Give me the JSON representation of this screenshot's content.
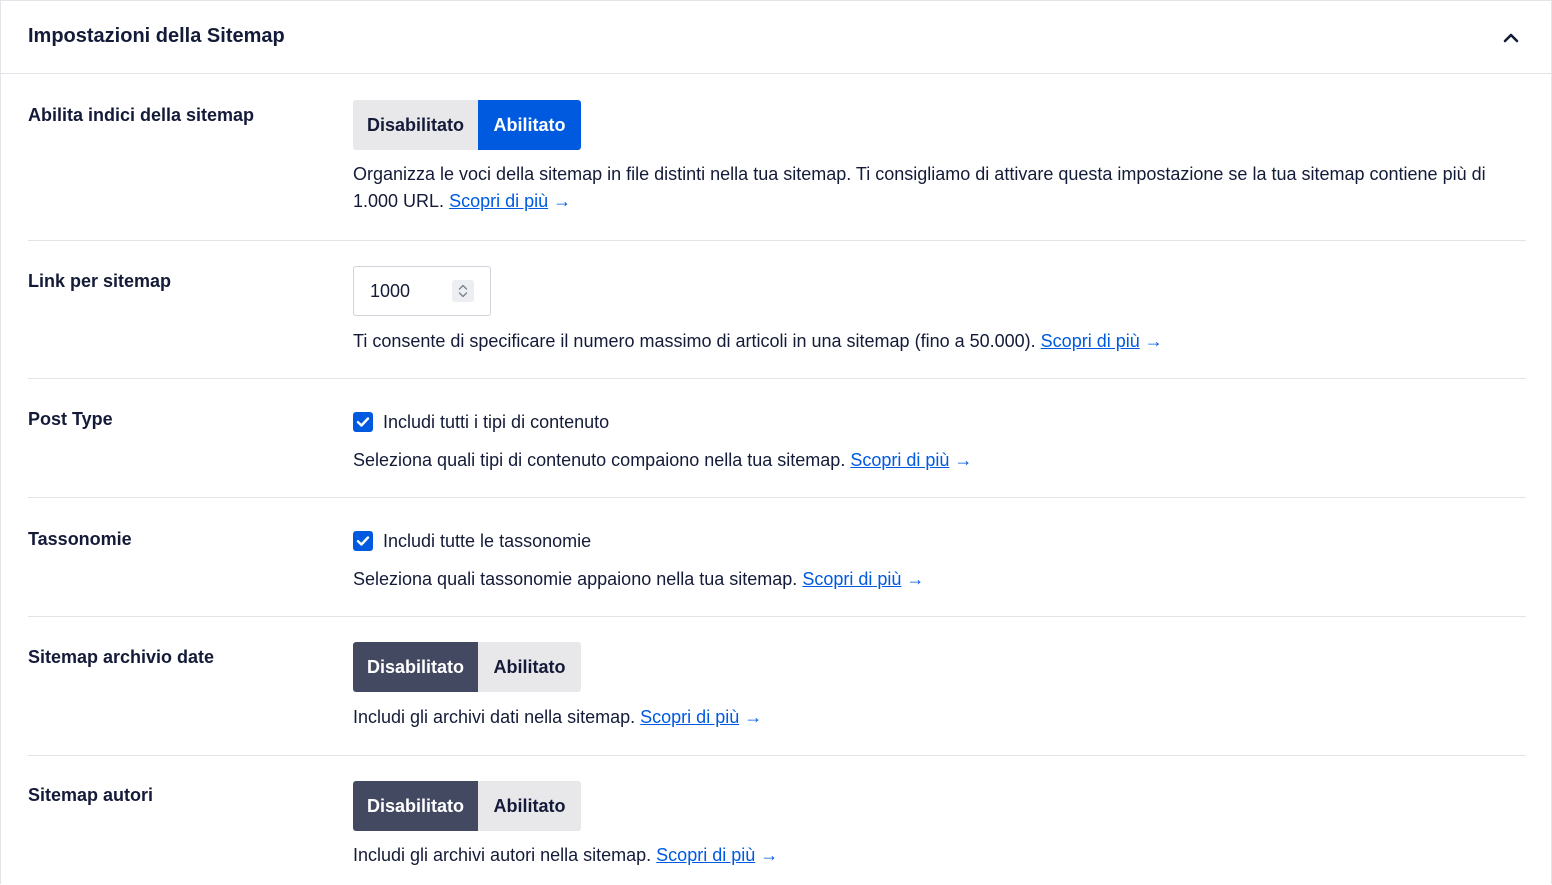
{
  "header": {
    "title": "Impostazioni della Sitemap",
    "collapse_icon": "chevron-up-icon"
  },
  "rows": [
    {
      "label": "Abilita indici della sitemap",
      "control": "toggle",
      "options": [
        "Disabilitato",
        "Abilitato"
      ],
      "selected": "Abilitato",
      "description": "Organizza le voci della sitemap in file distinti nella tua sitemap. Ti consigliamo di attivare questa impostazione se la tua sitemap contiene più di 1.000 URL.",
      "link": "Scopri di più",
      "arrow": "→"
    },
    {
      "label": "Link per sitemap",
      "control": "number",
      "value": "1000",
      "description": "Ti consente di specificare il numero massimo di articoli in una sitemap (fino a 50.000).",
      "link": "Scopri di più",
      "arrow": "→"
    },
    {
      "label": "Post Type",
      "control": "checkbox",
      "checkbox_label": "Includi tutti i tipi di contenuto",
      "checked": true,
      "description": "Seleziona quali tipi di contenuto compaiono nella tua sitemap.",
      "link": "Scopri di più",
      "arrow": "→"
    },
    {
      "label": "Tassonomie",
      "control": "checkbox",
      "checkbox_label": "Includi tutte le tassonomie",
      "checked": true,
      "description": "Seleziona quali tassonomie appaiono nella tua sitemap.",
      "link": "Scopri di più",
      "arrow": "→"
    },
    {
      "label": "Sitemap archivio date",
      "control": "toggle",
      "options": [
        "Disabilitato",
        "Abilitato"
      ],
      "selected": "Disabilitato",
      "description": "Includi gli archivi dati nella sitemap.",
      "link": "Scopri di più",
      "arrow": "→"
    },
    {
      "label": "Sitemap autori",
      "control": "toggle",
      "options": [
        "Disabilitato",
        "Abilitato"
      ],
      "selected": "Disabilitato",
      "description": "Includi gli archivi autori nella sitemap.",
      "link": "Scopri di più",
      "arrow": "→"
    }
  ],
  "colors": {
    "accent_blue": "#005ae0",
    "active_dark": "#434960",
    "inactive_bg": "#e8e8eb",
    "text": "#141b38",
    "border": "#e2e4e9"
  }
}
